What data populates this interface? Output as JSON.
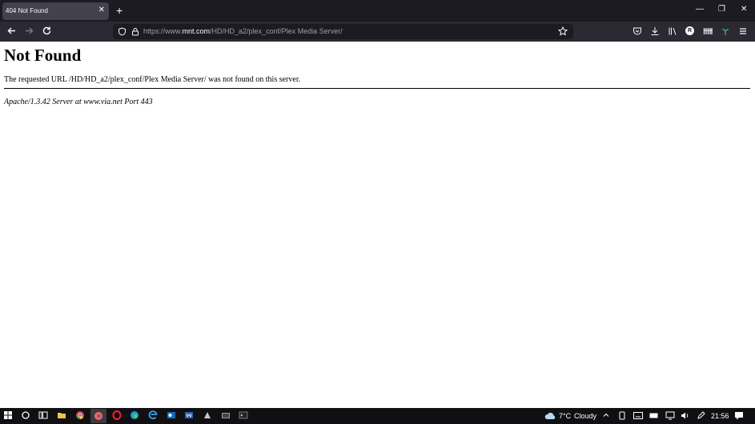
{
  "browser": {
    "tab_title": "404 Not Found",
    "tab_close": "✕",
    "new_tab": "+",
    "url_prefix": "https://www.",
    "url_domain": "mnt.com",
    "url_path": "/HD/HD_a2/plex_conf/Plex Media Server/",
    "profile_initial": "R",
    "window_controls": {
      "minimize": "—",
      "restore": "❐",
      "close": "✕"
    }
  },
  "page": {
    "heading": "Not Found",
    "message": "The requested URL /HD/HD_a2/plex_conf/Plex Media Server/ was not found on this server.",
    "address": "Apache/1.3.42 Server at www.via.net Port 443"
  },
  "taskbar": {
    "temperature": "7°C",
    "weather": "Cloudy",
    "time": "21:56"
  },
  "colors": {
    "tabbar_bg": "#1c1b22",
    "navbar_bg": "#2b2a33",
    "taskbar_bg": "#101012"
  },
  "icons": [
    "back-icon",
    "forward-icon",
    "reload-icon",
    "shield-icon",
    "lock-icon",
    "star-icon",
    "pocket-icon",
    "download-icon",
    "library-icon",
    "profile-icon",
    "extensions-icon",
    "menu-icon",
    "windows-start-icon",
    "search-icon",
    "task-view-icon",
    "file-explorer-icon",
    "chrome-icon",
    "firefox-icon",
    "opera-icon",
    "edge-icon",
    "outlook-icon",
    "word-icon",
    "weather-icon",
    "wifi-icon",
    "volume-icon",
    "notification-icon"
  ]
}
